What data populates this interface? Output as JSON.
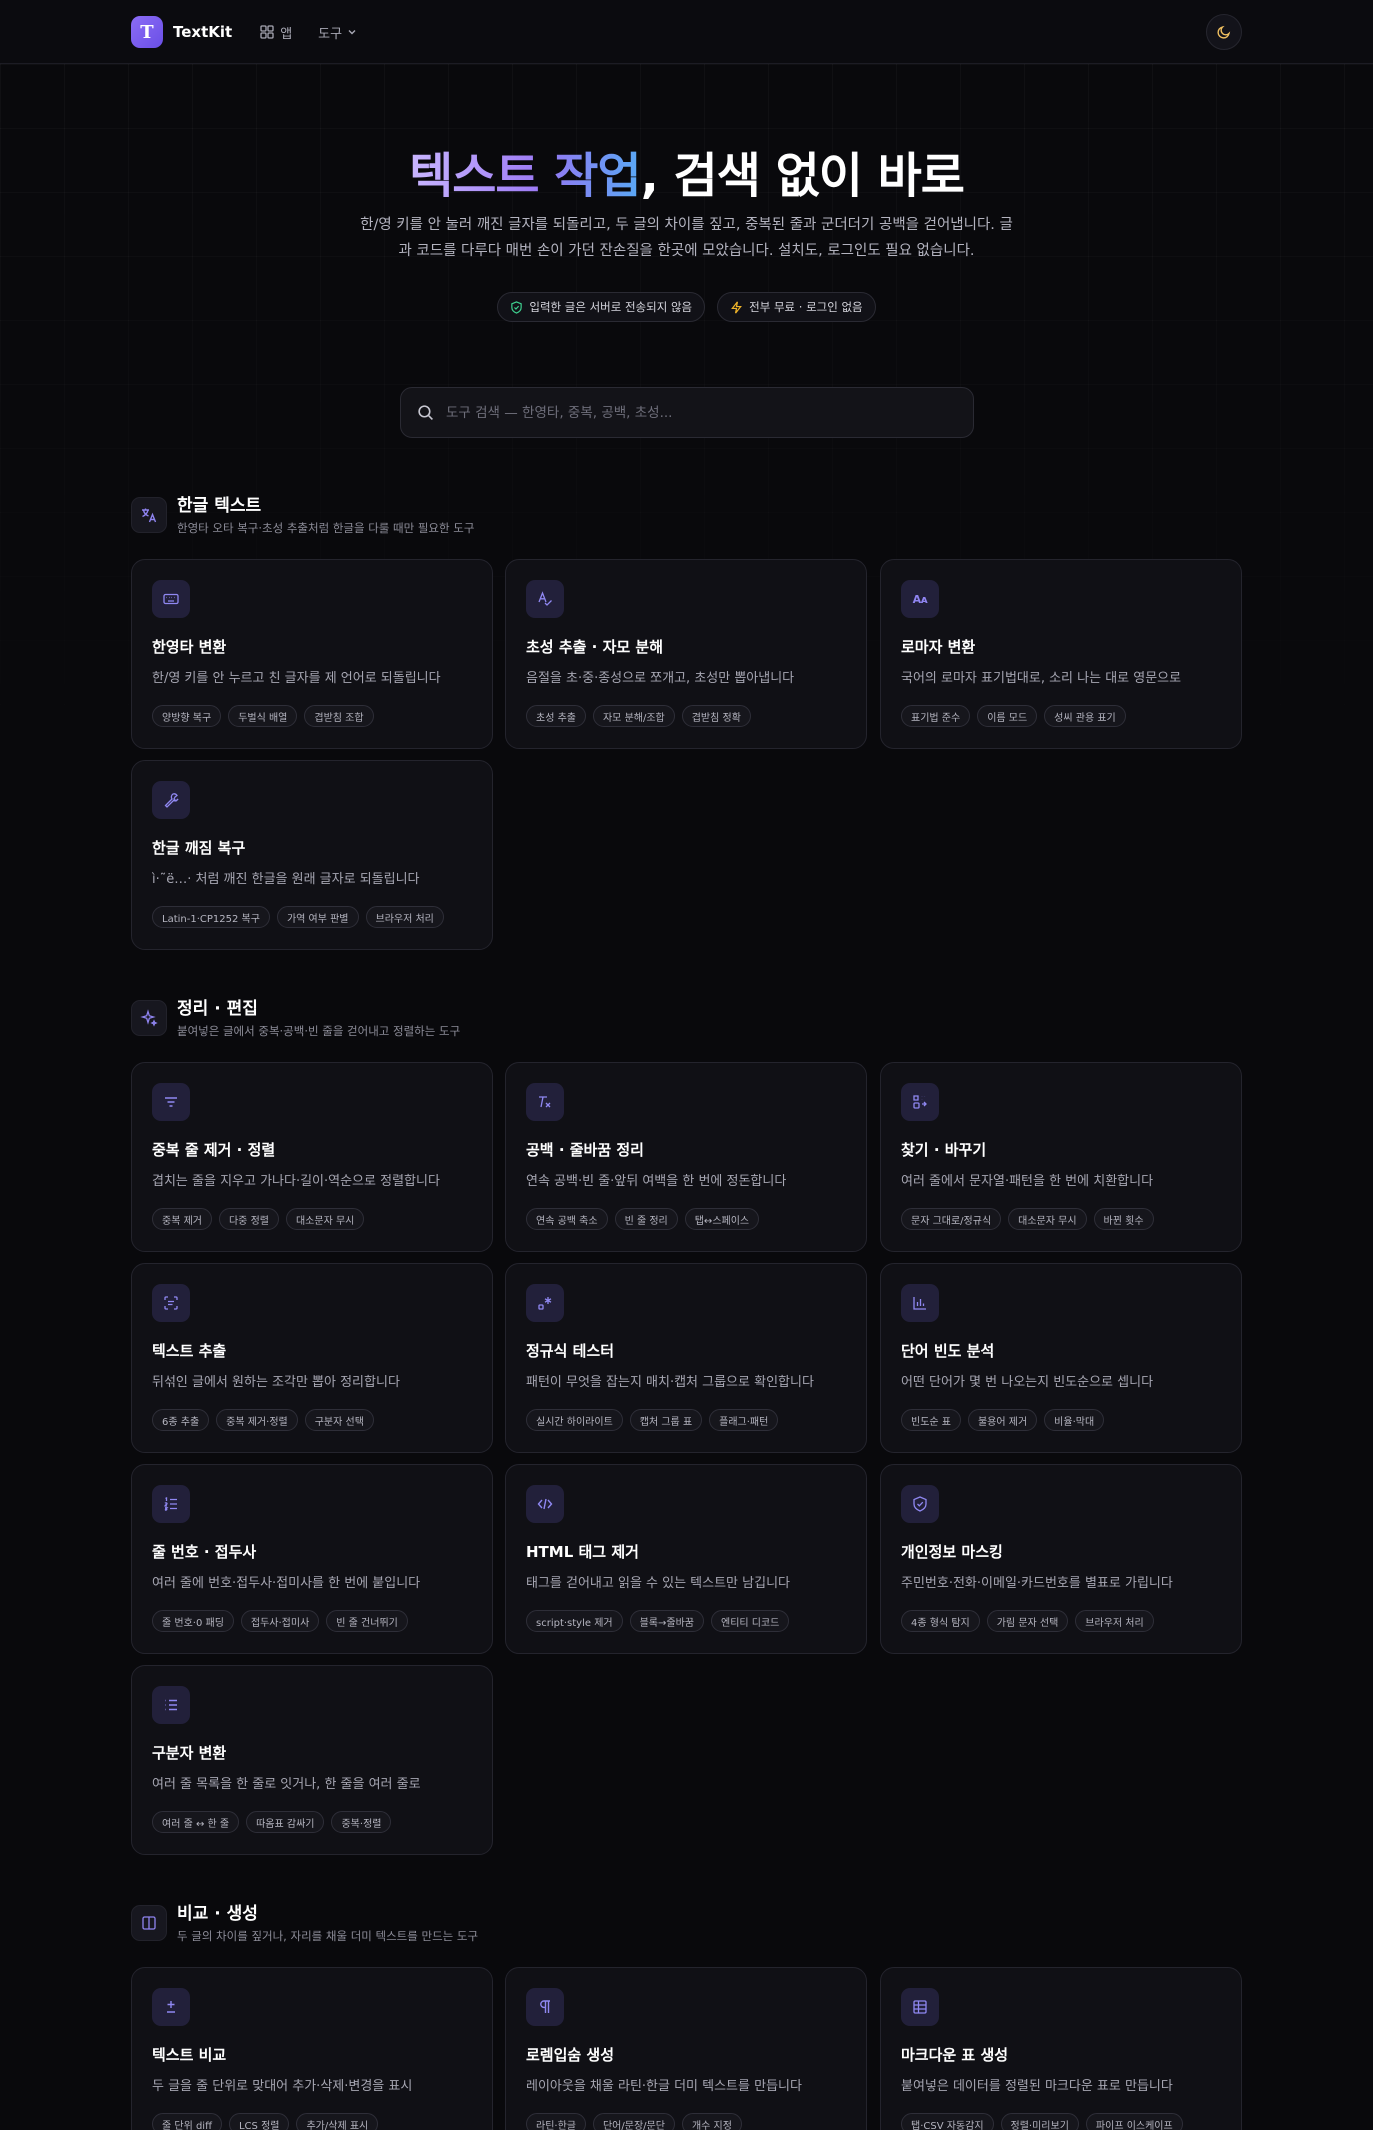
{
  "header": {
    "brand_letter": "T",
    "brand": "TextKit",
    "nav_apps": "앱",
    "nav_tools": "도구"
  },
  "hero": {
    "title_part1": "텍스트",
    "title_part2": "작업",
    "title_part3": ", 검색 없이 바로",
    "desc_line1": "한/영 키를 안 눌러 깨진 글자를 되돌리고, 두 글의 차이를 짚고, 중복된 줄과 군더더기 공백을 걷어냅니다. 글",
    "desc_line2": "과 코드를 다루다 매번 손이 가던 잔손질을 한곳에 모았습니다. 설치도, 로그인도 필요 없습니다.",
    "badges": [
      "입력한 글은 서버로 전송되지 않음",
      "전부 무료 · 로그인 없음"
    ]
  },
  "search": {
    "placeholder": "도구 검색 — 한영타, 중복, 공백, 초성..."
  },
  "sections": [
    {
      "title": "한글 텍스트",
      "subtitle": "한영타 오타 복구·초성 추출처럼 한글을 다룰 때만 필요한 도구",
      "icon": "translate-icon",
      "cards": [
        {
          "icon": "keyboard-icon",
          "title": "한영타 변환",
          "desc": "한/영 키를 안 누르고 친 글자를 제 언어로 되돌립니다",
          "tags": [
            "양방향 복구",
            "두벌식 배열",
            "겹받침 조합"
          ]
        },
        {
          "icon": "spellcheck-icon",
          "title": "초성 추출 · 자모 분해",
          "desc": "음절을 초·중·종성으로 쪼개고, 초성만 뽑아냅니다",
          "tags": [
            "초성 추출",
            "자모 분해/조합",
            "겹받침 정확"
          ]
        },
        {
          "icon": "romanize-icon",
          "icon_text": "Aᴀ",
          "title": "로마자 변환",
          "desc": "국어의 로마자 표기법대로, 소리 나는 대로 영문으로",
          "tags": [
            "표기법 준수",
            "이름 모드",
            "성씨 관용 표기"
          ]
        },
        {
          "icon": "wrench-icon",
          "title": "한글 깨짐 복구",
          "desc": "ì·˜ë…· 처럼 깨진 한글을 원래 글자로 되돌립니다",
          "tags": [
            "Latin-1·CP1252 복구",
            "가역 여부 판별",
            "브라우저 처리"
          ]
        }
      ]
    },
    {
      "title": "정리 · 편집",
      "subtitle": "붙여넣은 글에서 중복·공백·빈 줄을 걷어내고 정렬하는 도구",
      "icon": "sparkles-icon",
      "cards": [
        {
          "icon": "filter-icon",
          "title": "중복 줄 제거 · 정렬",
          "desc": "겹치는 줄을 지우고 가나다·길이·역순으로 정렬합니다",
          "tags": [
            "중복 제거",
            "다중 정렬",
            "대소문자 무시"
          ]
        },
        {
          "icon": "clear-format-icon",
          "title": "공백 · 줄바꿈 정리",
          "desc": "연속 공백·빈 줄·앞뒤 여백을 한 번에 정돈합니다",
          "tags": [
            "연속 공백 축소",
            "빈 줄 정리",
            "탭↔스페이스"
          ]
        },
        {
          "icon": "replace-icon",
          "title": "찾기 · 바꾸기",
          "desc": "여러 줄에서 문자열·패턴을 한 번에 치환합니다",
          "tags": [
            "문자 그대로/정규식",
            "대소문자 무시",
            "바뀐 횟수"
          ]
        },
        {
          "icon": "scan-text-icon",
          "title": "텍스트 추출",
          "desc": "뒤섞인 글에서 원하는 조각만 뽑아 정리합니다",
          "tags": [
            "6종 추출",
            "중복 제거·정렬",
            "구분자 선택"
          ]
        },
        {
          "icon": "regex-icon",
          "title": "정규식 테스터",
          "desc": "패턴이 무엇을 잡는지 매치·캡처 그룹으로 확인합니다",
          "tags": [
            "실시간 하이라이트",
            "캡처 그룹 표",
            "플래그·패턴"
          ]
        },
        {
          "icon": "bar-chart-icon",
          "title": "단어 빈도 분석",
          "desc": "어떤 단어가 몇 번 나오는지 빈도순으로 셉니다",
          "tags": [
            "빈도순 표",
            "불용어 제거",
            "비율·막대"
          ]
        },
        {
          "icon": "list-ordered-icon",
          "title": "줄 번호 · 접두사",
          "desc": "여러 줄에 번호·접두사·접미사를 한 번에 붙입니다",
          "tags": [
            "줄 번호·0 패딩",
            "접두사·접미사",
            "빈 줄 건너뛰기"
          ]
        },
        {
          "icon": "code-icon",
          "title": "HTML 태그 제거",
          "desc": "태그를 걷어내고 읽을 수 있는 텍스트만 남깁니다",
          "tags": [
            "script·style 제거",
            "블록→줄바꿈",
            "엔티티 디코드"
          ]
        },
        {
          "icon": "shield-check-icon",
          "title": "개인정보 마스킹",
          "desc": "주민번호·전화·이메일·카드번호를 별표로 가립니다",
          "tags": [
            "4종 형식 탐지",
            "가림 문자 선택",
            "브라우저 처리"
          ]
        },
        {
          "icon": "list-icon",
          "title": "구분자 변환",
          "desc": "여러 줄 목록을 한 줄로 잇거나, 한 줄을 여러 줄로",
          "tags": [
            "여러 줄 ↔ 한 줄",
            "따옴표 감싸기",
            "중복·정렬"
          ]
        }
      ]
    },
    {
      "title": "비교 · 생성",
      "subtitle": "두 글의 차이를 짚거나, 자리를 채울 더미 텍스트를 만드는 도구",
      "icon": "columns-icon",
      "cards": [
        {
          "icon": "plus-minus-icon",
          "title": "텍스트 비교",
          "desc": "두 글을 줄 단위로 맞대어 추가·삭제·변경을 표시",
          "tags": [
            "줄 단위 diff",
            "LCS 정렬",
            "추가/삭제 표시"
          ]
        },
        {
          "icon": "pilcrow-icon",
          "title": "로렘입숨 생성",
          "desc": "레이아웃을 채울 라틴·한글 더미 텍스트를 만듭니다",
          "tags": [
            "라틴·한글",
            "단어/문장/문단",
            "개수 지정"
          ]
        },
        {
          "icon": "table-icon",
          "title": "마크다운 표 생성",
          "desc": "붙여넣은 데이터를 정렬된 마크다운 표로 만듭니다",
          "tags": [
            "탭·CSV 자동감지",
            "정렬·미리보기",
            "파이프 이스케이프"
          ]
        }
      ]
    }
  ],
  "colors": {
    "accent": "#8b6cf6",
    "icon_stroke": "#9088f2",
    "background": "#09090c",
    "card": "#101015"
  }
}
